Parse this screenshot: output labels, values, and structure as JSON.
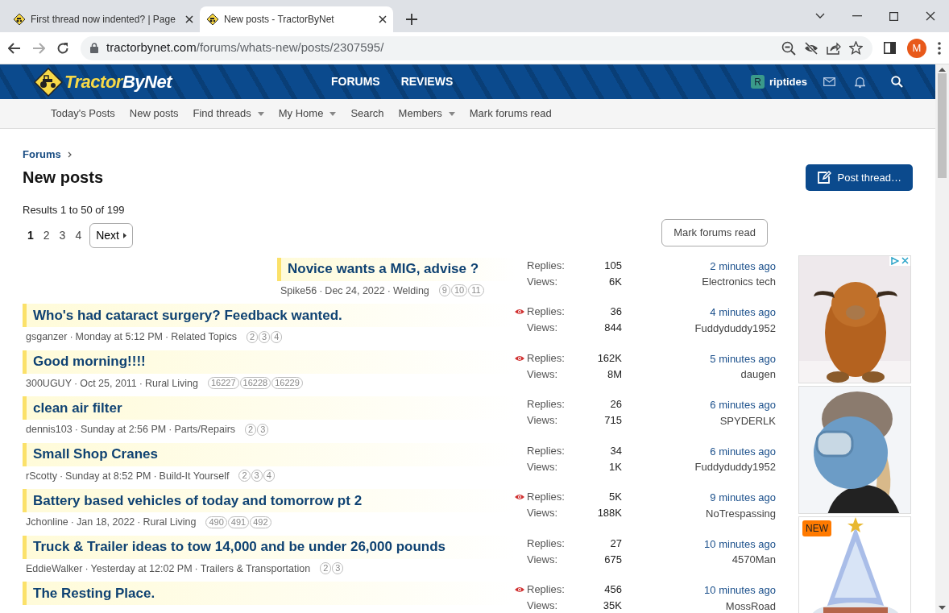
{
  "browser": {
    "tabs": [
      {
        "title": "First thread now indented? | Page",
        "selected": false
      },
      {
        "title": "New posts - TractorByNet",
        "selected": true
      }
    ],
    "url_host": "tractorbynet.com",
    "url_path": "/forums/whats-new/posts/2307595/",
    "profile_initial": "M"
  },
  "site": {
    "logo_parts": [
      "Tractor",
      "ByNet"
    ],
    "nav": [
      "FORUMS",
      "REVIEWS"
    ],
    "user": {
      "initial": "R",
      "name": "riptides"
    },
    "subnav": [
      {
        "label": "Today's Posts",
        "dropdown": false
      },
      {
        "label": "New posts",
        "dropdown": false
      },
      {
        "label": "Find threads",
        "dropdown": true
      },
      {
        "label": "My Home",
        "dropdown": true
      },
      {
        "label": "Search",
        "dropdown": false
      },
      {
        "label": "Members",
        "dropdown": true
      },
      {
        "label": "Mark forums read",
        "dropdown": false
      }
    ]
  },
  "breadcrumb": [
    "Forums"
  ],
  "page_title": "New posts",
  "post_button": "Post thread…",
  "results": "Results 1 to 50 of 199",
  "pagination": {
    "pages": [
      {
        "label": "1",
        "selected": true
      },
      {
        "label": "2",
        "selected": false
      },
      {
        "label": "3",
        "selected": false
      },
      {
        "label": "4",
        "selected": false
      }
    ],
    "next": "Next"
  },
  "mark_read_button": "Mark forums read",
  "threads": [
    {
      "title": "Novice wants a MIG, advise ?",
      "indented": true,
      "author": "Spike56",
      "date": "Dec 24, 2022",
      "forum": "Welding",
      "meta_separators": [
        "·",
        "·"
      ],
      "pages": [
        "9",
        "10",
        "11"
      ],
      "watched": false,
      "replies_label": "Replies:",
      "replies": "105",
      "views_label": "Views:",
      "views": "6K",
      "last_time": "2 minutes ago",
      "last_user": "Electronics tech"
    },
    {
      "title": "Who's had cataract surgery? Feedback wanted.",
      "indented": false,
      "author": "gsganzer",
      "date": "Monday at 5:12 PM",
      "forum": "Related Topics",
      "meta_separators": [
        "·",
        "·"
      ],
      "pages": [
        "2",
        "3",
        "4"
      ],
      "watched": true,
      "replies_label": "Replies:",
      "replies": "36",
      "views_label": "Views:",
      "views": "844",
      "last_time": "4 minutes ago",
      "last_user": "Fuddyduddy1952"
    },
    {
      "title": "Good morning!!!!",
      "indented": false,
      "author": "300UGUY",
      "date": "Oct 25, 2011",
      "forum": "Rural Living",
      "meta_separators": [
        "·",
        "·"
      ],
      "pages": [
        "16227",
        "16228",
        "16229"
      ],
      "watched": true,
      "replies_label": "Replies:",
      "replies": "162K",
      "views_label": "Views:",
      "views": "8M",
      "last_time": "5 minutes ago",
      "last_user": "daugen"
    },
    {
      "title": "clean air filter",
      "indented": false,
      "author": "dennis103",
      "date": "Sunday at 2:56 PM",
      "forum": "Parts/Repairs",
      "meta_separators": [
        "·",
        "·"
      ],
      "pages": [
        "2",
        "3"
      ],
      "watched": false,
      "replies_label": "Replies:",
      "replies": "26",
      "views_label": "Views:",
      "views": "715",
      "last_time": "6 minutes ago",
      "last_user": "SPYDERLK"
    },
    {
      "title": "Small Shop Cranes",
      "indented": false,
      "author": "rScotty",
      "date": "Sunday at 8:52 PM",
      "forum": "Build-It Yourself",
      "meta_separators": [
        "·",
        "·"
      ],
      "pages": [
        "2",
        "3",
        "4"
      ],
      "watched": false,
      "replies_label": "Replies:",
      "replies": "34",
      "views_label": "Views:",
      "views": "1K",
      "last_time": "6 minutes ago",
      "last_user": "Fuddyduddy1952"
    },
    {
      "title": "Battery based vehicles of today and tomorrow pt 2",
      "indented": false,
      "author": "Jchonline",
      "date": "Jan 18, 2022",
      "forum": "Rural Living",
      "meta_separators": [
        "·",
        "·"
      ],
      "pages": [
        "490",
        "491",
        "492"
      ],
      "watched": true,
      "replies_label": "Replies:",
      "replies": "5K",
      "views_label": "Views:",
      "views": "188K",
      "last_time": "9 minutes ago",
      "last_user": "NoTrespassing"
    },
    {
      "title": "Truck & Trailer ideas to tow 14,000 and be under 26,000 pounds",
      "indented": false,
      "author": "EddieWalker",
      "date": "Yesterday at 12:02 PM",
      "forum": "Trailers & Transportation",
      "meta_separators": [
        "·",
        "·"
      ],
      "pages": [
        "2",
        "3"
      ],
      "watched": false,
      "replies_label": "Replies:",
      "replies": "27",
      "views_label": "Views:",
      "views": "675",
      "last_time": "10 minutes ago",
      "last_user": "4570Man"
    },
    {
      "title": "The Resting Place.",
      "indented": false,
      "watched": true,
      "replies_label": "Replies:",
      "replies": "456",
      "views_label": "Views:",
      "views": "35K",
      "last_time": "10 minutes ago",
      "last_user": "MossRoad"
    }
  ],
  "ads": [
    {
      "kind": "plush"
    },
    {
      "kind": "mask"
    },
    {
      "kind": "tree",
      "badge": "NEW"
    }
  ]
}
